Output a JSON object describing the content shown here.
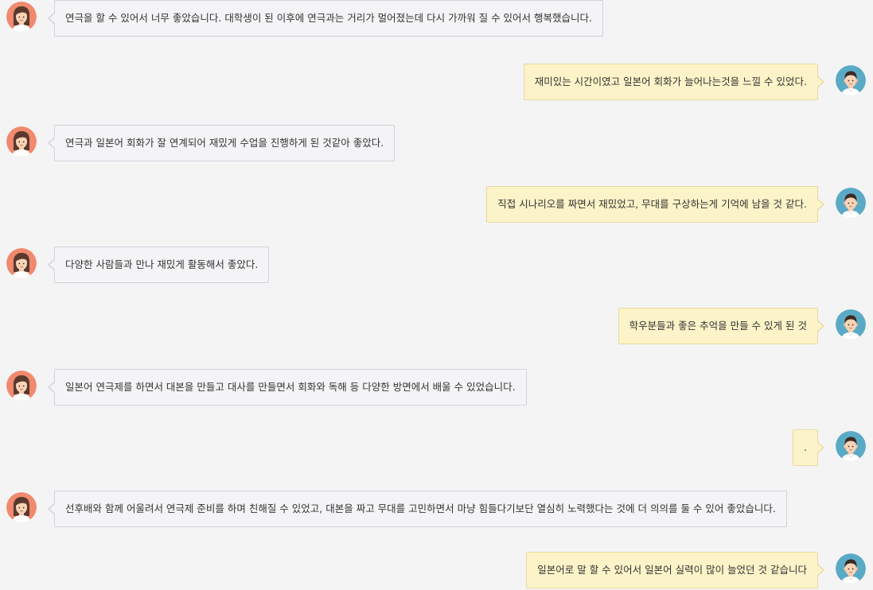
{
  "theme": {
    "page_background": "#f4f4f5",
    "student_bubble_background": "#f4f4f6",
    "student_bubble_border": "#cfd3dc",
    "teacher_bubble_background": "#fdf3c8",
    "teacher_bubble_border": "#ead9a0",
    "female_avatar_background": "#f1896e",
    "male_avatar_background": "#5aaac6"
  },
  "messages": [
    {
      "side": "left",
      "avatar": "female-avatar-icon",
      "text": "연극을 할 수 있어서 너무 좋았습니다. 대학생이 된 이후에 연극과는 거리가 멀어졌는데 다시 가까워 질 수 있어서 행복했습니다."
    },
    {
      "side": "right",
      "avatar": "male-avatar-icon",
      "text": "재미있는 시간이였고 일본어 회화가 늘어나는것을 느낄 수 있었다."
    },
    {
      "side": "left",
      "avatar": "female-avatar-icon",
      "text": "연극과 일본어 회화가 잘 연계되어 재밌게 수업을 진행하게 된 것같아 좋았다."
    },
    {
      "side": "right",
      "avatar": "male-avatar-icon",
      "text": "직접 시나리오를 짜면서 재밌었고, 무대를 구상하는게 기억에 남을 것 같다."
    },
    {
      "side": "left",
      "avatar": "female-avatar-icon",
      "text": "다양한 사람들과 만나 재밌게 활동해서 좋았다."
    },
    {
      "side": "right",
      "avatar": "male-avatar-icon",
      "text": "학우분들과 좋은 추억을 만들 수 있게 된 것"
    },
    {
      "side": "left",
      "avatar": "female-avatar-icon",
      "text": "일본어 연극제를 하면서 대본을 만들고 대사를 만들면서 회화와 독해 등 다양한 방면에서 배울 수 있었습니다."
    },
    {
      "side": "right",
      "avatar": "male-avatar-icon",
      "text": "."
    },
    {
      "side": "left",
      "avatar": "female-avatar-icon",
      "text": "선후배와 함께 어울려서 연극제 준비를 하며 친해질 수 있었고, 대본을 짜고 무대를 고민하면서 마냥 힘들다기보단 열심히 노력했다는 것에 더 의의를 둘 수 있어 좋았습니다."
    },
    {
      "side": "right",
      "avatar": "male-avatar-icon",
      "text": "일본어로 말 할 수 있어서 일본어 실력이 많이 늘었던 것 같습니다"
    }
  ]
}
